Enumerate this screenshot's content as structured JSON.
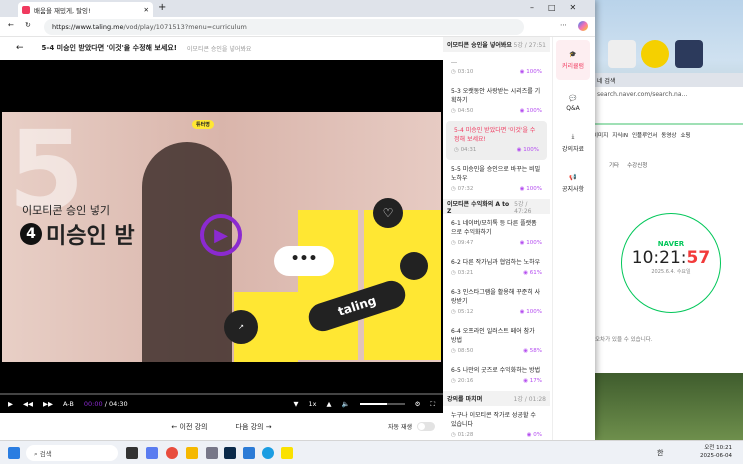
{
  "browser": {
    "tab_title": "배움을 재밌게, 탈잉!",
    "url_prefix": "https://www.taling.me",
    "url_rest": "/vod/play/1071513?menu=curriculum"
  },
  "header": {
    "title": "5-4 미승인 받았다면 '이것'을 수정해 보세요!",
    "subtitle": "이모티콘 승인을 넣어봐요"
  },
  "video": {
    "badge": "튜터명",
    "overlay_subtitle": "이모티콘 승인 넣기",
    "overlay_number": "4",
    "overlay_title": "미승인 받",
    "big_number": "5",
    "sticker_text": "taling"
  },
  "controls": {
    "ab": "A-B",
    "current": "00:00",
    "total": "04:30",
    "speed": "1x",
    "volume": 0.6,
    "progress": 0.0
  },
  "nav": {
    "prev": "← 이전 강의",
    "next": "다음 강의 →",
    "autoplay": "자동 재생"
  },
  "sections": [
    {
      "title": "이모티콘 승인을 넣어봐요",
      "meta": "5강 / 27:51",
      "items": [
        {
          "title": "…",
          "time": "03:10",
          "pct": "100%"
        },
        {
          "title": "5-3 오랫동안 사랑받는 시리즈를 기획하기",
          "time": "04:50",
          "pct": "100%"
        },
        {
          "title": "5-4 미승인 받았다면 '이것'을 수정해 보세요!",
          "time": "04:31",
          "pct": "100%",
          "active": true
        },
        {
          "title": "5-5 미승인을 승인으로 바꾸는 비밀 노하우",
          "time": "07:32",
          "pct": "100%"
        }
      ]
    },
    {
      "title": "이모티콘 수익화의 A to Z",
      "meta": "5강 / 47:26",
      "items": [
        {
          "title": "6-1 네이버/모히톡 등 다른 플랫폼으로 수익화하기",
          "time": "09:47",
          "pct": "100%"
        },
        {
          "title": "6-2 다른 작가님과 협업하는 노하우",
          "time": "03:21",
          "pct": "61%"
        },
        {
          "title": "6-3 인스타그램을 활용해 꾸준히 사랑받기",
          "time": "05:12",
          "pct": "100%"
        },
        {
          "title": "6-4 오프라인 일러스트 페어 참가 방법",
          "time": "08:50",
          "pct": "58%"
        },
        {
          "title": "6-5 나만의 굿즈로 수익화하는 방법",
          "time": "20:16",
          "pct": "17%"
        }
      ]
    },
    {
      "title": "강의를 마치며",
      "meta": "1강 / 01:28",
      "items": [
        {
          "title": "누구나 이모티콘 작가로 성공할 수 있습니다",
          "time": "01:28",
          "pct": "0%"
        }
      ]
    }
  ],
  "rail": [
    "커리큘럼",
    "Q&A",
    "강의자료",
    "공지사항"
  ],
  "naver": {
    "url": "search.naver.com/search.na...",
    "tab": "네 검색",
    "chips": [
      "이미지",
      "지식iN",
      "인플루언서",
      "동영상",
      "쇼핑"
    ],
    "chips2": [
      "기타",
      "수강신청"
    ],
    "brand": "NAVER",
    "clock_hm": "10:21:",
    "clock_s": "57",
    "date": "2025.6.4. 수요일",
    "note": "오차가 있을 수 있습니다."
  },
  "taskbar": {
    "search": "검색",
    "time": "오전 10:21",
    "date": "2025-06-04",
    "lang": "한"
  },
  "colors": {
    "accent": "#f03a5f",
    "purple": "#b44cf0",
    "yellow": "#ffe733",
    "naver": "#03c75a"
  }
}
